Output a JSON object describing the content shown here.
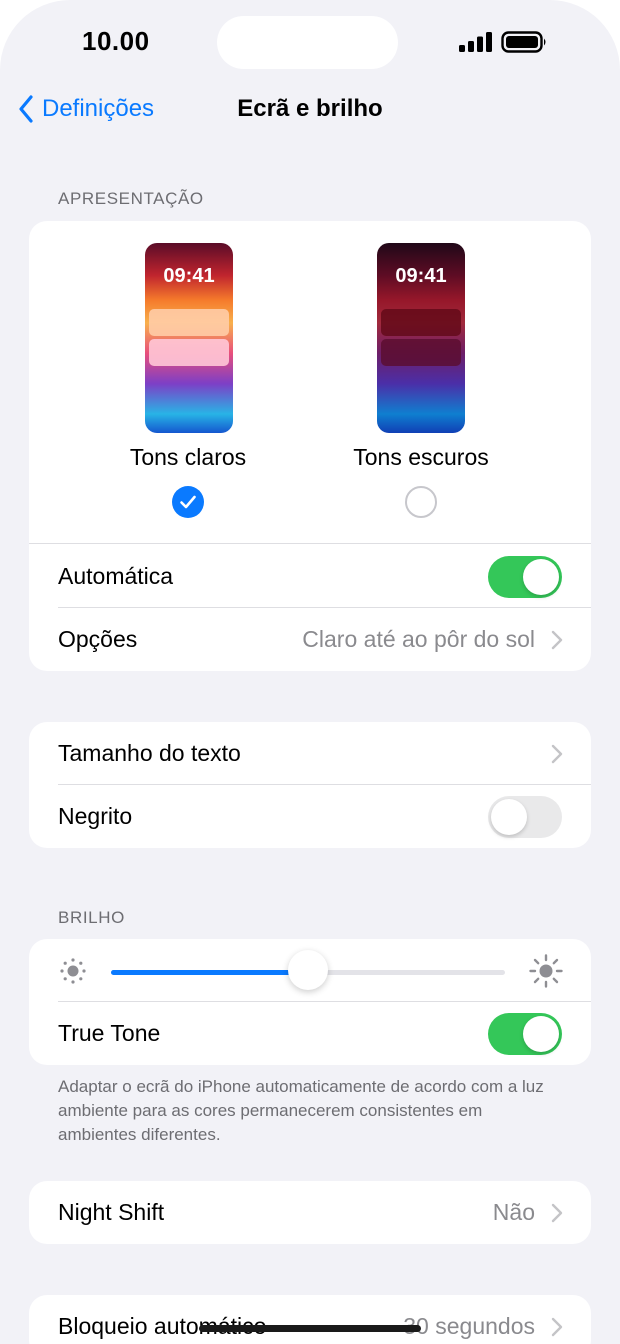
{
  "status_bar": {
    "time": "10.00"
  },
  "nav": {
    "back_label": "Definições",
    "title": "Ecrã e brilho"
  },
  "appearance": {
    "header": "APRESENTAÇÃO",
    "light": {
      "preview_time": "09:41",
      "label": "Tons claros",
      "selected": true
    },
    "dark": {
      "preview_time": "09:41",
      "label": "Tons escuros",
      "selected": false
    },
    "automatic": {
      "label": "Automática",
      "on": true
    },
    "options": {
      "label": "Opções",
      "value": "Claro até ao pôr do sol"
    }
  },
  "text_settings": {
    "text_size": {
      "label": "Tamanho do texto"
    },
    "bold": {
      "label": "Negrito",
      "on": false
    }
  },
  "brightness": {
    "header": "BRILHO",
    "level": 0.5,
    "true_tone": {
      "label": "True Tone",
      "on": true
    },
    "footnote": "Adaptar o ecrã do iPhone automaticamente de acordo com a luz ambiente para as cores permanecerem consistentes em ambientes diferentes."
  },
  "night_shift": {
    "label": "Night Shift",
    "value": "Não"
  },
  "auto_lock": {
    "label": "Bloqueio automático",
    "value": "30 segundos"
  },
  "colors": {
    "accent": "#0a7aff",
    "toggle_on": "#34c759",
    "background": "#f2f2f7"
  }
}
